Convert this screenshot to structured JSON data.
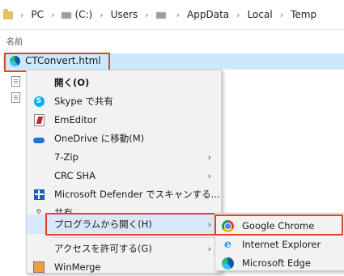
{
  "address": {
    "crumbs": [
      "PC",
      "(C:)",
      "Users",
      "AppData",
      "Local",
      "Temp"
    ]
  },
  "column_header": "名前",
  "file": {
    "name": "CTConvert.html"
  },
  "menu": {
    "open": "開く(O)",
    "skype": "Skype で共有",
    "emeditor": "EmEditor",
    "onedrive": "OneDrive に移動(M)",
    "sevenzip": "7-Zip",
    "crcsha": "CRC SHA",
    "defender": "Microsoft Defender でスキャンする...",
    "share": "共有",
    "open_with": "プログラムから開く(H)",
    "grant_access": "アクセスを許可する(G)",
    "winmerge": "WinMerge"
  },
  "submenu": {
    "chrome": "Google Chrome",
    "ie": "Internet Explorer",
    "edge": "Microsoft Edge"
  },
  "colors": {
    "highlight_box": "#e2461f",
    "selection": "#cce8ff"
  }
}
